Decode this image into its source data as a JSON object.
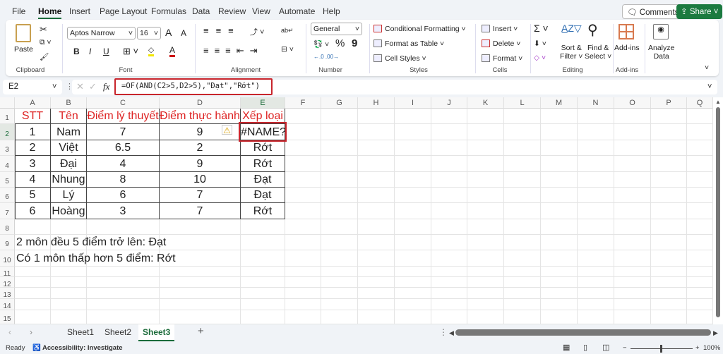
{
  "menu": {
    "tabs": [
      "File",
      "Home",
      "Insert",
      "Page Layout",
      "Formulas",
      "Data",
      "Review",
      "View",
      "Automate",
      "Help"
    ],
    "active": "Home"
  },
  "top_buttons": {
    "comments": "Comments",
    "share": "Share"
  },
  "ribbon": {
    "clipboard": {
      "paste": "Paste",
      "label": "Clipboard"
    },
    "font": {
      "name": "Aptos Narrow",
      "size": "16",
      "bold": "B",
      "italic": "I",
      "underline": "U",
      "grow": "A",
      "shrink": "A",
      "color_letter": "A",
      "label": "Font"
    },
    "alignment": {
      "label": "Alignment"
    },
    "number": {
      "format": "General",
      "percent": "%",
      "comma": "9",
      "label": "Number"
    },
    "styles": {
      "conditional": "Conditional Formatting",
      "format_table": "Format as Table",
      "cell_styles": "Cell Styles",
      "label": "Styles"
    },
    "cells": {
      "insert": "Insert",
      "delete": "Delete",
      "format": "Format",
      "label": "Cells"
    },
    "editing": {
      "sum": "Σ",
      "sort1": "Sort &",
      "sort2": "Filter",
      "find1": "Find &",
      "find2": "Select",
      "label": "Editing"
    },
    "addins": {
      "addins": "Add-ins",
      "label": "Add-ins"
    },
    "analyze": {
      "line1": "Analyze",
      "line2": "Data"
    }
  },
  "formula_bar": {
    "name_box": "E2",
    "fx": "fx",
    "formula": "=OF(AND(C2>5,D2>5),\"Đạt\",\"Rớt\")"
  },
  "accent": {
    "highlight": "#c8252c",
    "header_text": "#d92b2b",
    "brand": "#1b7a40"
  },
  "grid": {
    "columns": [
      "A",
      "B",
      "C",
      "D",
      "E",
      "F",
      "G",
      "H",
      "I",
      "J",
      "K",
      "L",
      "M",
      "N",
      "O",
      "P",
      "Q"
    ],
    "rows": [
      "1",
      "2",
      "3",
      "4",
      "5",
      "6",
      "7",
      "8",
      "9",
      "10",
      "11",
      "12",
      "13",
      "14",
      "15"
    ],
    "table_header": [
      "STT",
      "Tên",
      "Điểm lý thuyết",
      "Điểm thực hành",
      "Xếp loại"
    ],
    "table_rows": [
      [
        "1",
        "Nam",
        "7",
        "9",
        "#NAME?"
      ],
      [
        "2",
        "Việt",
        "6.5",
        "2",
        "Rớt"
      ],
      [
        "3",
        "Đại",
        "4",
        "9",
        "Rớt"
      ],
      [
        "4",
        "Nhung",
        "8",
        "10",
        "Đạt"
      ],
      [
        "5",
        "Lý",
        "6",
        "7",
        "Đạt"
      ],
      [
        "6",
        "Hoàng",
        "3",
        "7",
        "Rớt"
      ]
    ],
    "notes": [
      "2 môn đều 5 điểm trở lên: Đạt",
      "Có 1 môn thấp hơn 5 điểm: Rớt"
    ],
    "selected_cell": "E2",
    "error_icon": "warning-icon"
  },
  "sheets": {
    "tabs": [
      "Sheet1",
      "Sheet2",
      "Sheet3"
    ],
    "active": "Sheet3",
    "add": "+"
  },
  "status": {
    "ready": "Ready",
    "accessibility": "Accessibility: Investigate",
    "zoom": "100%"
  }
}
